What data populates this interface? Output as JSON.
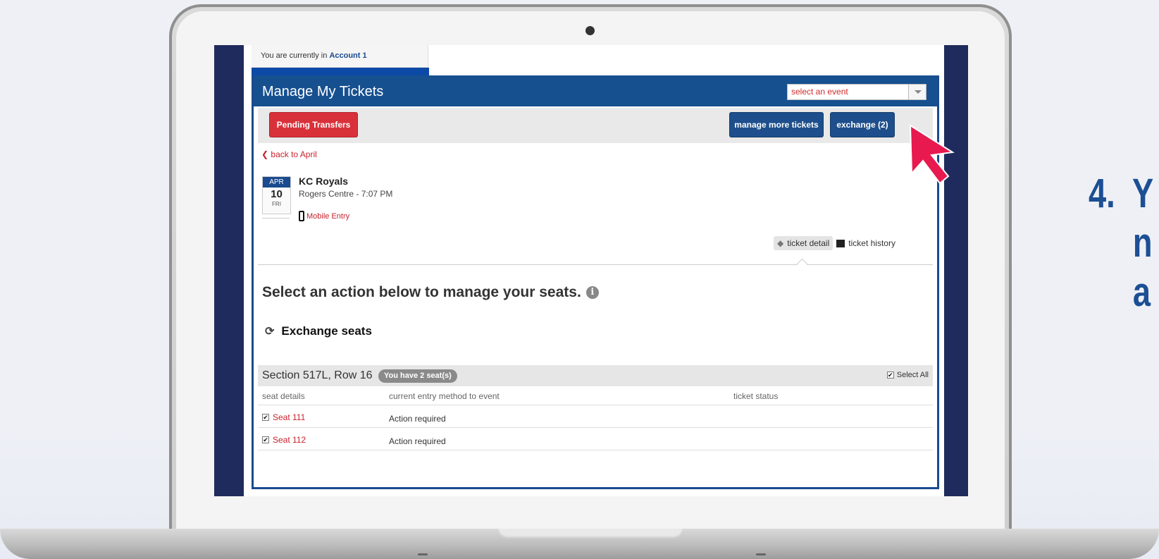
{
  "account": {
    "prefix": "You are currently in",
    "name": "Account 1"
  },
  "panel": {
    "title": "Manage My Tickets",
    "event_select_placeholder": "select an event"
  },
  "buttons": {
    "pending_transfers": "Pending Transfers",
    "manage_more": "manage more tickets",
    "exchange": "exchange (2)"
  },
  "back_link": "back to April",
  "event": {
    "month": "APR",
    "day": "10",
    "dow": "FRI",
    "name": "KC Royals",
    "venue_time": "Rogers Centre - 7:07 PM",
    "entry": "Mobile Entry"
  },
  "tabs": {
    "detail": "ticket detail",
    "history": "ticket history"
  },
  "heading": "Select an action below to manage your seats.",
  "exchange_label": "Exchange seats",
  "section": {
    "title": "Section 517L, Row 16",
    "seats_pill": "You have 2 seat(s)",
    "select_all": "Select All"
  },
  "columns": {
    "seat_details": "seat details",
    "entry_method": "current entry method to event",
    "ticket_status": "ticket status"
  },
  "rows": [
    {
      "seat": "Seat 111",
      "status": "Action required",
      "checked": true
    },
    {
      "seat": "Seat 112",
      "status": "Action required",
      "checked": true
    }
  ],
  "side_caption": "4.  Y\n     n\n     a",
  "colors": {
    "brand_blue": "#16508f",
    "accent_red": "#d9313a",
    "cursor": "#e8194f",
    "caption_blue": "#1c4f94"
  }
}
